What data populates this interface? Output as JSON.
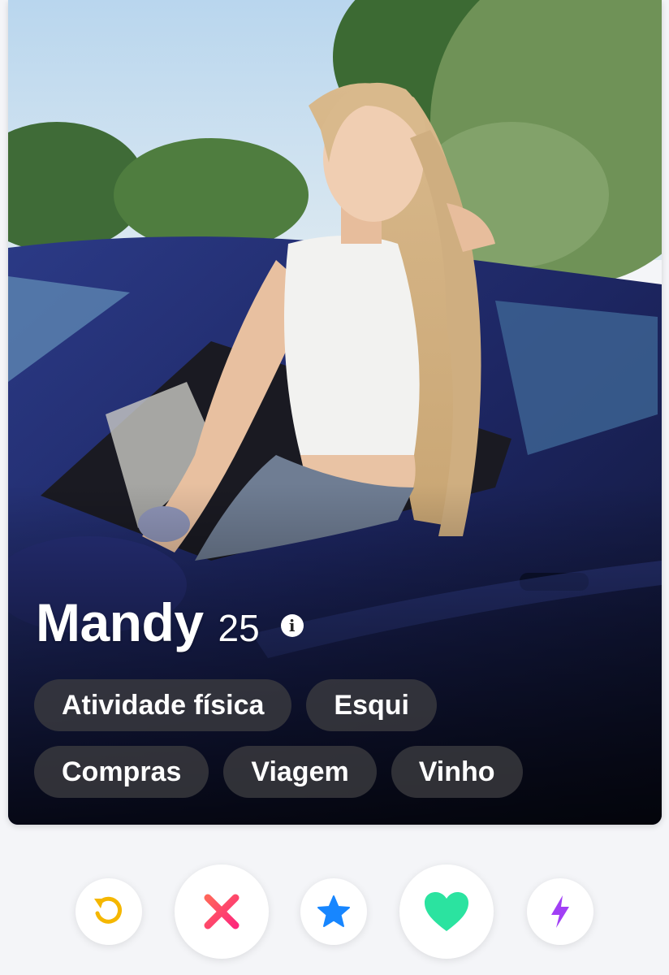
{
  "profile": {
    "name": "Mandy",
    "age": "25",
    "info_glyph": "i",
    "interests": [
      "Atividade física",
      "Esqui",
      "Compras",
      "Viagem",
      "Vinho"
    ]
  },
  "actions": [
    {
      "name": "rewind-button",
      "icon": "rewind-icon",
      "color": "#f5b700"
    },
    {
      "name": "nope-button",
      "icon": "x-icon",
      "color": "#ff4458"
    },
    {
      "name": "super-like-button",
      "icon": "star-icon",
      "color": "#1786ff"
    },
    {
      "name": "like-button",
      "icon": "heart-icon",
      "color": "#2be3a0"
    },
    {
      "name": "boost-button",
      "icon": "bolt-icon",
      "color": "#a13ff5"
    }
  ]
}
